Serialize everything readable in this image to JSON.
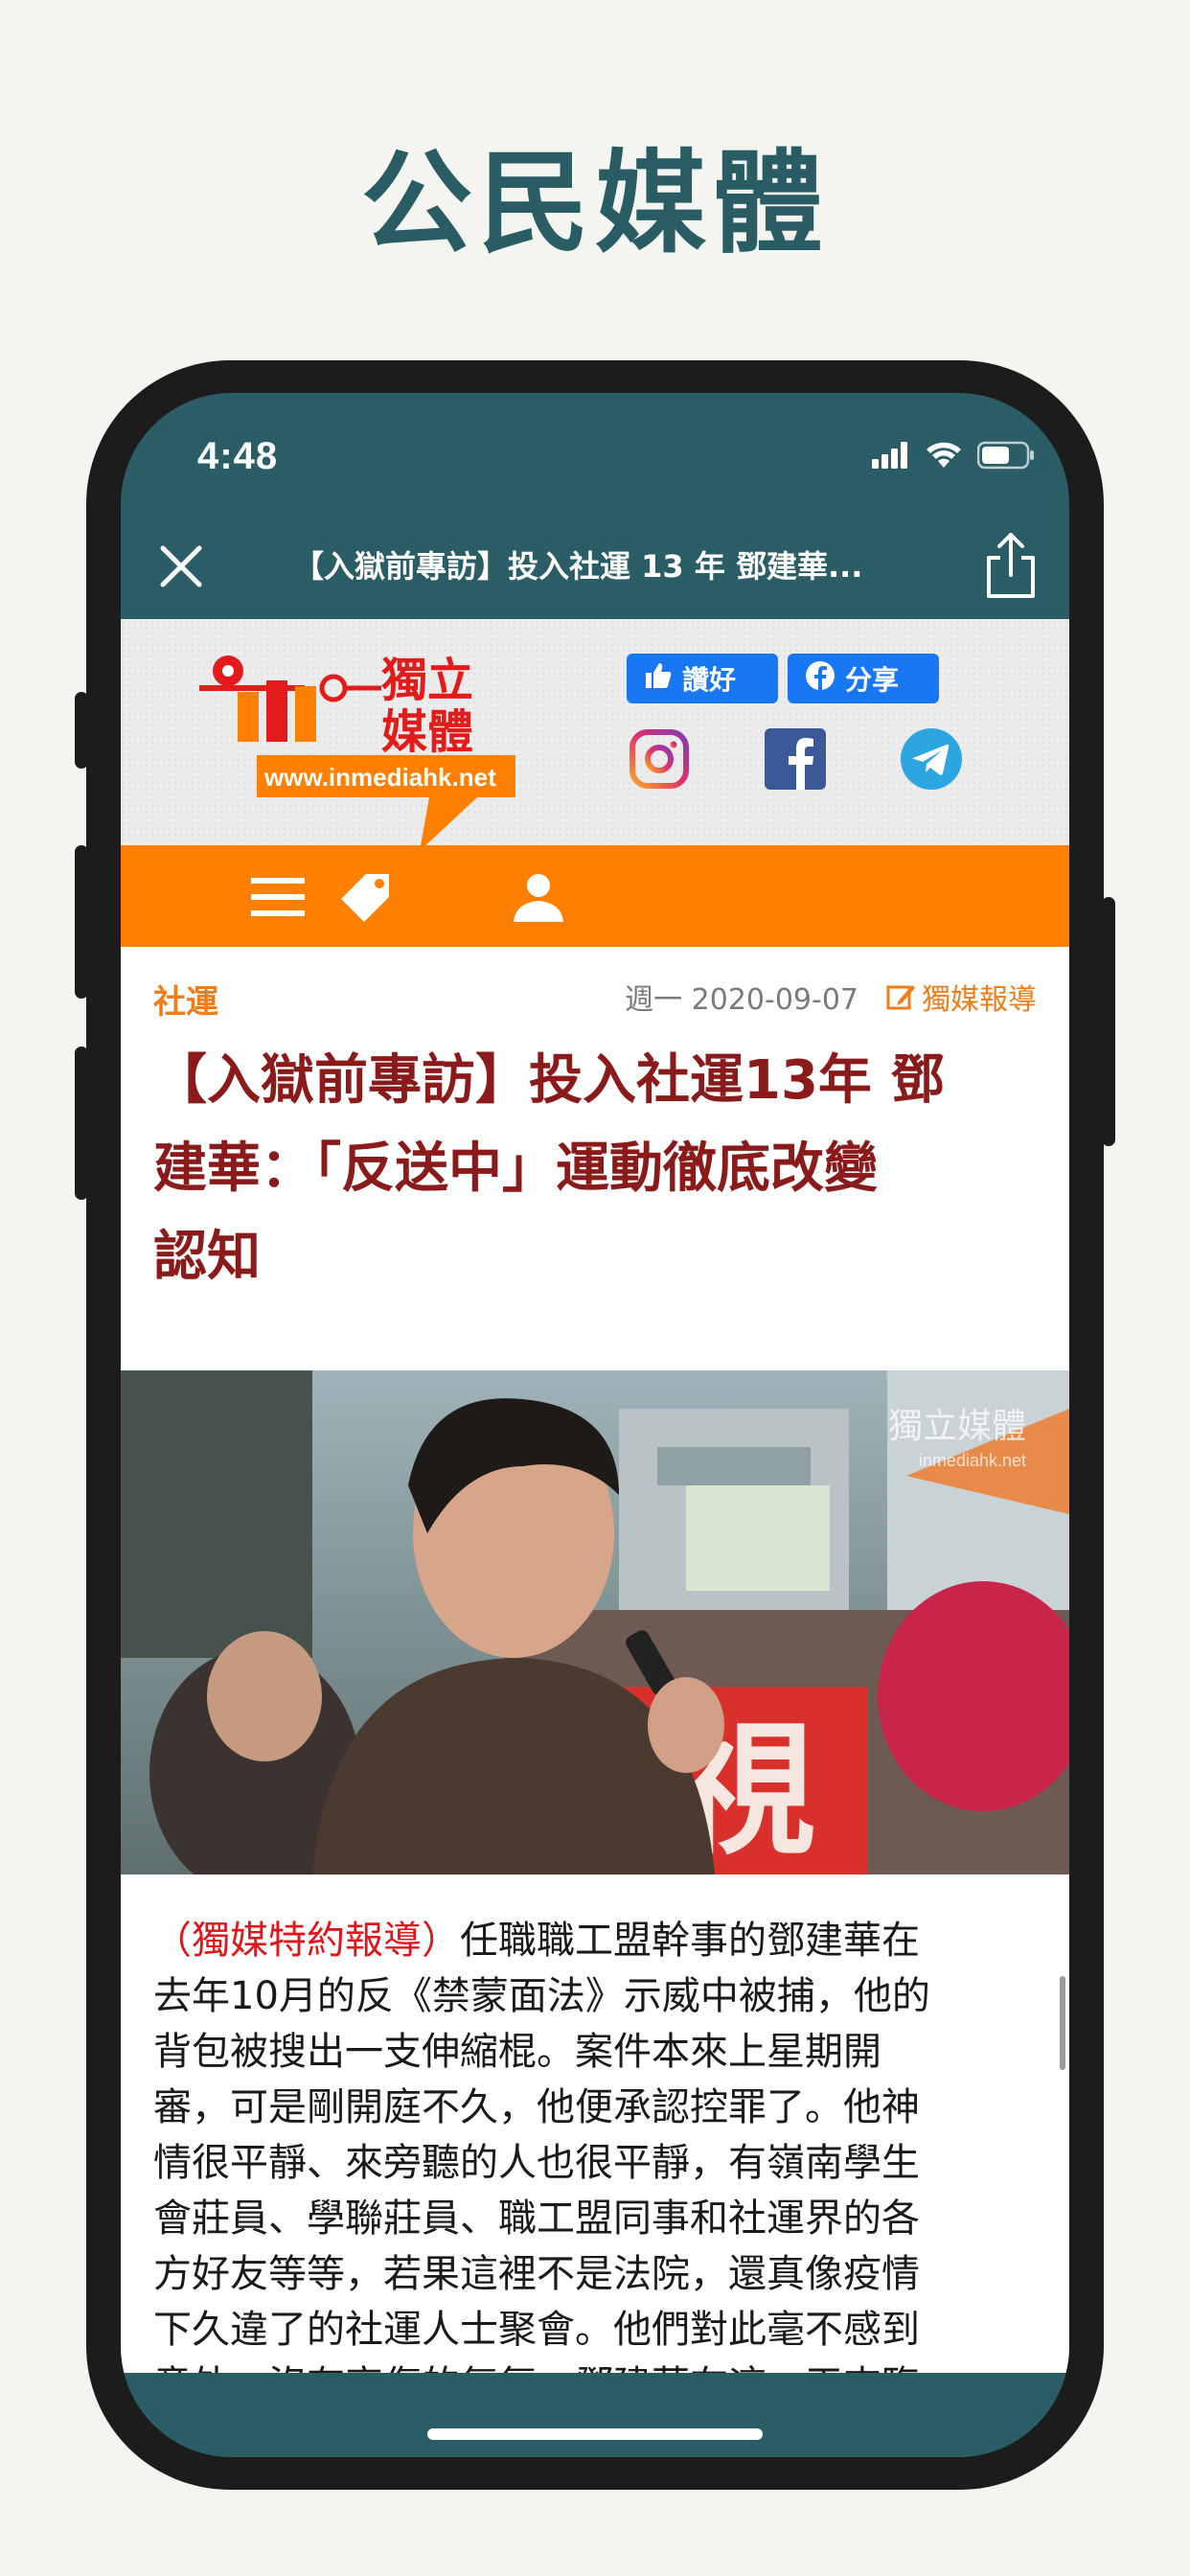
{
  "page_heading": "公民媒體",
  "status_bar": {
    "time": "4:48"
  },
  "nav": {
    "title": "【入獄前專訪】投入社運 13 年 鄧建華..."
  },
  "site_header": {
    "logo_text_top": "獨立",
    "logo_text_bottom": "媒體",
    "logo_url": "www.inmediahk.net",
    "like_label": "讚好",
    "share_label": "分享"
  },
  "article": {
    "category": "社運",
    "date": "週一 2020-09-07",
    "source": "獨媒報導",
    "headline_lines": [
      "【入獄前專訪】投入社運13年 鄧",
      "建華：「反送中」運動徹底改變",
      "認知"
    ],
    "photo_watermark_top": "獨立媒體",
    "photo_watermark_bottom": "inmediahk.net",
    "photo_sign_text": "視",
    "body_lead": "（獨媒特約報導）",
    "body_lines": [
      "任職職工盟幹事的鄧建華在",
      "去年10月的反《禁蒙面法》示威中被捕，他的",
      "背包被搜出一支伸縮棍。案件本來上星期開",
      "審，可是剛開庭不久，他便承認控罪了。他神",
      "情很平靜、來旁聽的人也很平靜，有嶺南學生",
      "會莊員、學聯莊員、職工盟同事和社運界的各",
      "方好友等等，若果這裡不是法院，還真像疫情",
      "下久違了的社運人士聚會。他們對此毫不感到",
      "意外，沒有哀傷的氣氛。鄧建華在這一天來臨"
    ]
  },
  "colors": {
    "teal": "#2b5d66",
    "orange": "#ff7f00",
    "headline_red": "#8b1a1a",
    "category_orange": "#f07d1a",
    "facebook_blue": "#1877f2"
  }
}
